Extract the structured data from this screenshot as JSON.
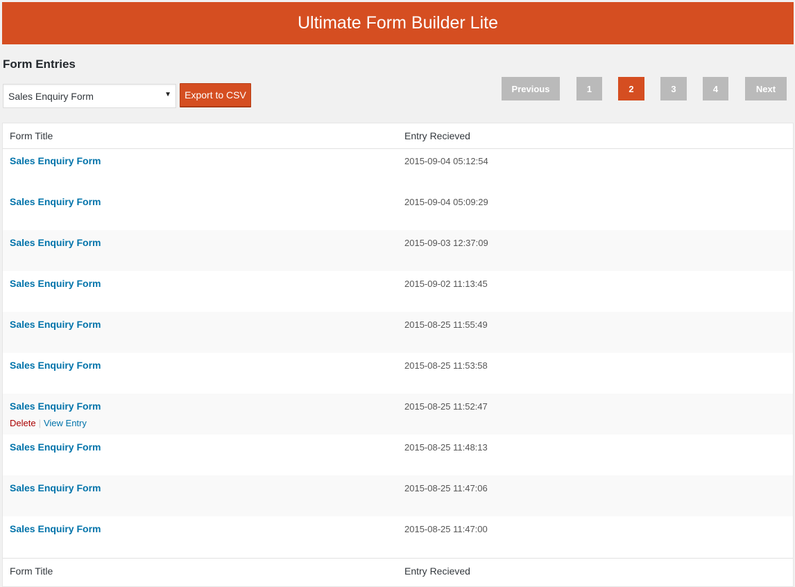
{
  "app": {
    "title": "Ultimate Form Builder Lite"
  },
  "page": {
    "heading": "Form Entries"
  },
  "controls": {
    "form_select_value": "Sales Enquiry Form",
    "export_label": "Export to CSV"
  },
  "pagination": {
    "previous_label": "Previous",
    "pages": [
      "1",
      "2",
      "3",
      "4"
    ],
    "current_page": "2",
    "next_label": "Next"
  },
  "table": {
    "columns": [
      "Form Title",
      "Entry Recieved"
    ],
    "rows": [
      {
        "title": "Sales Enquiry Form",
        "received": "2015-09-04 05:12:54"
      },
      {
        "title": "Sales Enquiry Form",
        "received": "2015-09-04 05:09:29"
      },
      {
        "title": "Sales Enquiry Form",
        "received": "2015-09-03 12:37:09"
      },
      {
        "title": "Sales Enquiry Form",
        "received": "2015-09-02 11:13:45"
      },
      {
        "title": "Sales Enquiry Form",
        "received": "2015-08-25 11:55:49"
      },
      {
        "title": "Sales Enquiry Form",
        "received": "2015-08-25 11:53:58"
      },
      {
        "title": "Sales Enquiry Form",
        "received": "2015-08-25 11:52:47"
      },
      {
        "title": "Sales Enquiry Form",
        "received": "2015-08-25 11:48:13"
      },
      {
        "title": "Sales Enquiry Form",
        "received": "2015-08-25 11:47:06"
      },
      {
        "title": "Sales Enquiry Form",
        "received": "2015-08-25 11:47:00"
      }
    ],
    "row_actions": {
      "delete_label": "Delete",
      "separator": "|",
      "view_label": "View Entry"
    }
  },
  "colors": {
    "accent": "#d54e21",
    "link": "#0073aa",
    "delete": "#aa0000",
    "pager_inactive": "#bababa"
  }
}
